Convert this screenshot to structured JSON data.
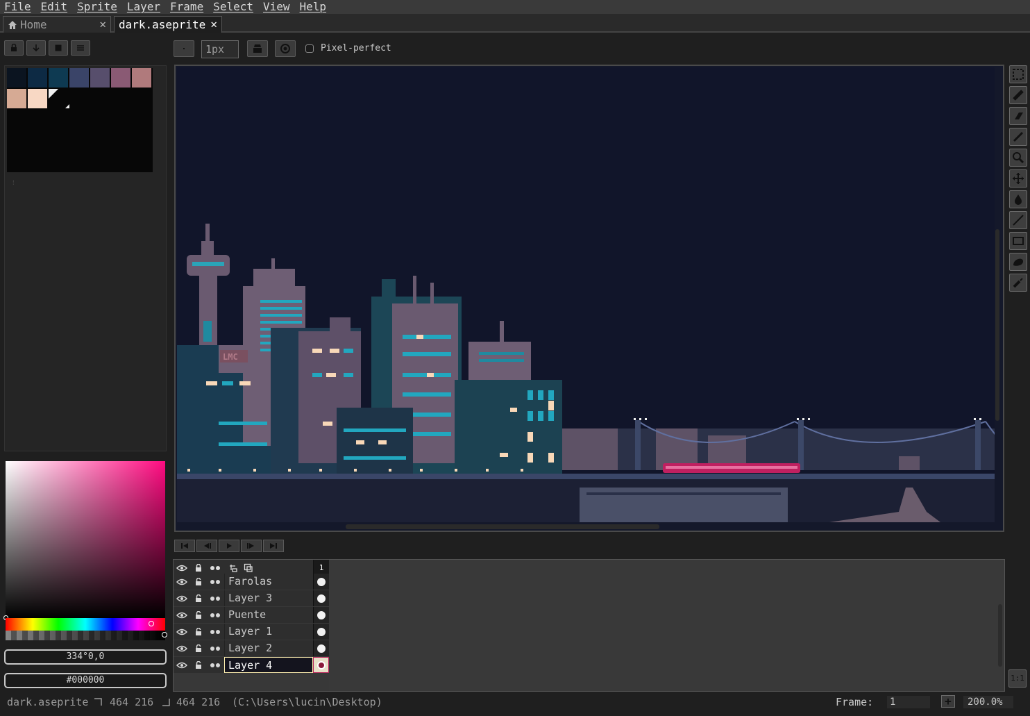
{
  "menu": [
    "File",
    "Edit",
    "Sprite",
    "Layer",
    "Frame",
    "Select",
    "View",
    "Help"
  ],
  "tabs": [
    {
      "label": "Home",
      "icon": "home-icon"
    },
    {
      "label": "dark.aseprite"
    }
  ],
  "tab_close": "✕",
  "toolbar": {
    "brush_size": "1px",
    "pixel_perfect_label": "Pixel-perfect",
    "pixel_perfect_checked": false
  },
  "palette": {
    "colors": [
      "#0b1420",
      "#0d2a44",
      "#0e3a52",
      "#3a4468",
      "#574e6c",
      "#8a5a74",
      "#b07a7c",
      "#d6aa94",
      "#f8d8c4"
    ]
  },
  "color_picker": {
    "hsv_field": "334°0,0",
    "hex_field": "#000000"
  },
  "canvas": {
    "sign_text": "LMC"
  },
  "timeline": {
    "frame_header": "1",
    "layers": [
      {
        "name": "Farolas",
        "active": false
      },
      {
        "name": "Layer 3",
        "active": false
      },
      {
        "name": "Puente",
        "active": false
      },
      {
        "name": "Layer 1",
        "active": false
      },
      {
        "name": "Layer 2",
        "active": false
      },
      {
        "name": "Layer 4",
        "active": true
      }
    ]
  },
  "status": {
    "filename": "dark.aseprite",
    "size_a": "464 216",
    "size_b": "464 216",
    "path": "(C:\\Users\\lucin\\Desktop)",
    "frame_label": "Frame:",
    "frame_value": "1",
    "zoom": "200.0%",
    "add_frame_symbol": "+",
    "zoom_fit_label": "1:1"
  }
}
